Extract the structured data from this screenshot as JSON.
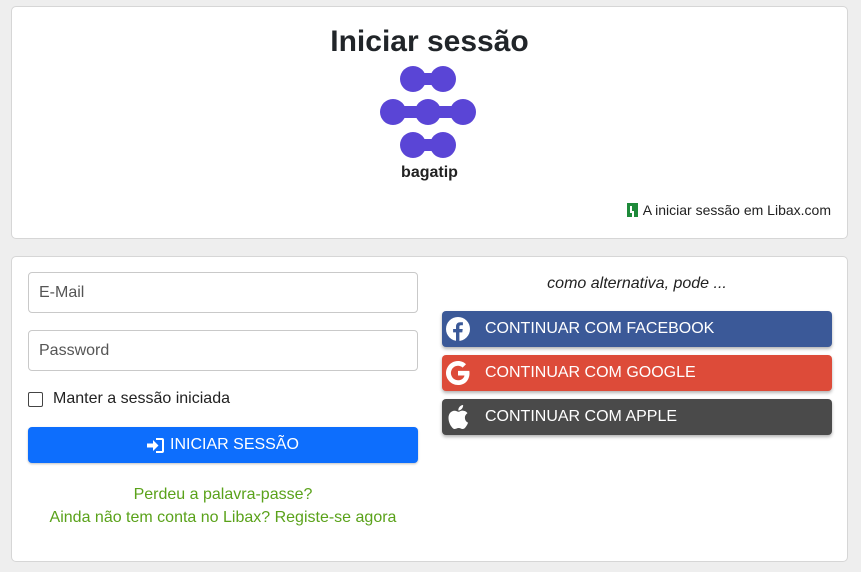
{
  "header": {
    "title": "Iniciar sessão",
    "brand_name": "bagatip",
    "signin_note": "A iniciar sessão em Libax.com",
    "logo_color": "#5a45d6"
  },
  "login_form": {
    "email_placeholder": "E-Mail",
    "password_placeholder": "Password",
    "remember_label": "Manter a sessão iniciada",
    "remember_checked": false,
    "submit_label": "INICIAR SESSÃO",
    "submit_color": "#0d6efd",
    "forgot_link": "Perdeu a palavra-passe?",
    "register_link": "Ainda não tem conta no Libax? Registe-se agora",
    "link_color": "#5aa21a"
  },
  "alternatives": {
    "intro": "como alternativa, pode ...",
    "buttons": [
      {
        "label": "CONTINUAR COM FACEBOOK",
        "icon": "facebook-icon",
        "color": "#3b5998"
      },
      {
        "label": "CONTINUAR COM GOOGLE",
        "icon": "google-icon",
        "color": "#dd4b39"
      },
      {
        "label": "CONTINUAR COM APPLE",
        "icon": "apple-icon",
        "color": "#4a4a4a"
      }
    ]
  }
}
